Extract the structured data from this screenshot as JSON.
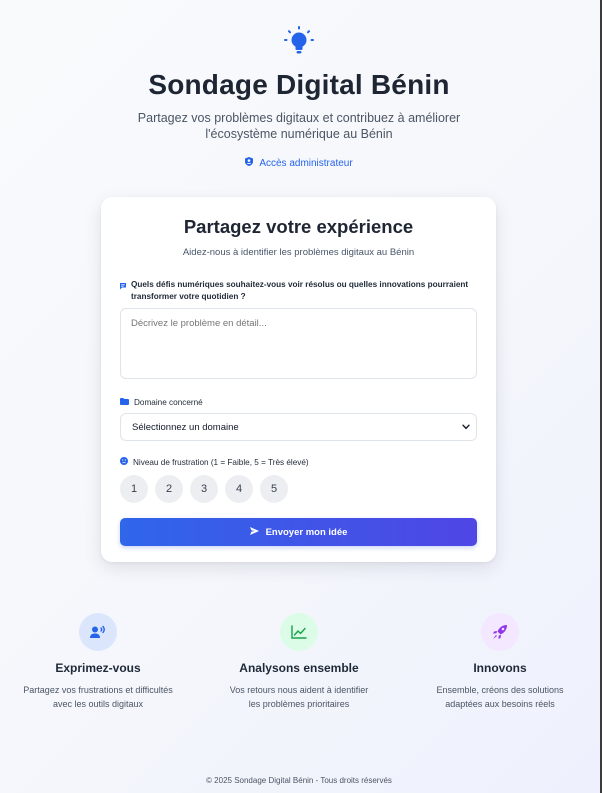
{
  "header": {
    "icon": "lightbulb-icon",
    "title": "Sondage Digital Bénin",
    "subtitle_line1": "Partagez vos problèmes digitaux et contribuez à améliorer",
    "subtitle_line2": "l'écosystème numérique au Bénin",
    "admin_link": "Accès administrateur",
    "accent_color": "#2563eb"
  },
  "form": {
    "title": "Partagez votre expérience",
    "subtitle": "Aidez-nous à identifier les problèmes digitaux au Bénin",
    "question_label": "Quels défis numériques souhaitez-vous voir résolus ou quelles innovations pourraient transformer votre quotidien ?",
    "textarea_placeholder": "Décrivez le problème en détail...",
    "textarea_value": "",
    "domain_label": "Domaine concerné",
    "domain_selected": "Sélectionnez un domaine",
    "frustration_label": "Niveau de frustration (1 = Faible, 5 = Très élevé)",
    "ratings": [
      "1",
      "2",
      "3",
      "4",
      "5"
    ],
    "submit_label": "Envoyer mon idée",
    "button_gradient": [
      "#2f66ea",
      "#4f46e5"
    ]
  },
  "features": [
    {
      "icon": "voice-user-icon",
      "title": "Exprimez-vous",
      "text": "Partagez vos frustrations et difficultés avec les outils digitaux",
      "color": "#2563eb"
    },
    {
      "icon": "chart-line-icon",
      "title": "Analysons ensemble",
      "text": "Vos retours nous aident à identifier les problèmes prioritaires",
      "color": "#16a34a"
    },
    {
      "icon": "rocket-icon",
      "title": "Innovons",
      "text": "Ensemble, créons des solutions adaptées aux besoins réels",
      "color": "#9333ea"
    }
  ],
  "footer": {
    "text": "© 2025 Sondage Digital Bénin - Tous droits réservés"
  }
}
